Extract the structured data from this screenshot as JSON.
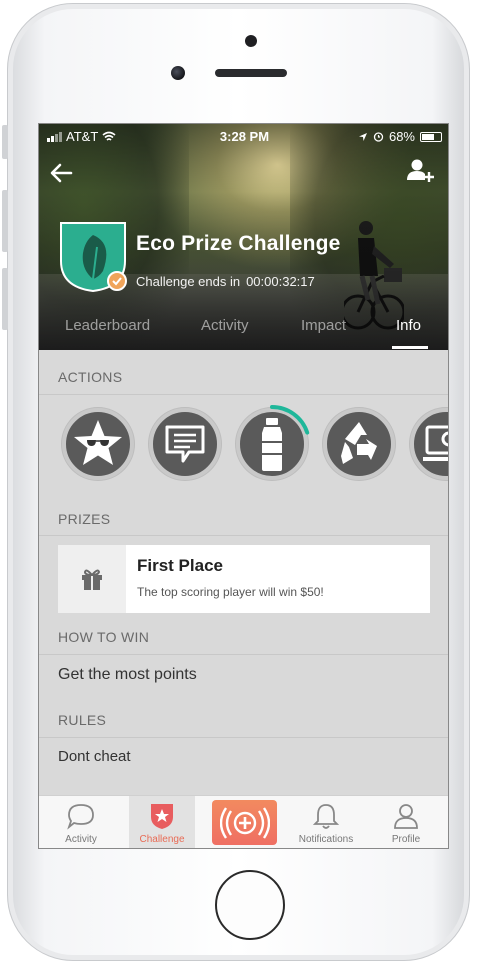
{
  "status_bar": {
    "carrier": "AT&T",
    "time": "3:28 PM",
    "battery": "68%",
    "battery_level": 0.68
  },
  "header": {
    "title": "Eco Prize Challenge",
    "ends_label": "Challenge ends in",
    "timer": "00:00:32:17"
  },
  "tabs": [
    {
      "label": "Leaderboard"
    },
    {
      "label": "Activity"
    },
    {
      "label": "Impact"
    },
    {
      "label": "Info",
      "active": true
    }
  ],
  "sections": {
    "actions": "ACTIONS",
    "prizes": "PRIZES",
    "how_to_win": "HOW TO WIN",
    "rules": "RULES"
  },
  "actions": [
    {
      "icon": "star-sunglasses-icon"
    },
    {
      "icon": "message-icon"
    },
    {
      "icon": "water-bottle-icon",
      "progress": 0.2
    },
    {
      "icon": "recycle-icon"
    },
    {
      "icon": "computer-settings-icon"
    }
  ],
  "prize": {
    "title": "First Place",
    "description": "The top scoring player will win $50!",
    "icon": "gift-icon"
  },
  "how_to_win": "Get the most points",
  "rules": "Dont cheat",
  "bottom_nav": [
    {
      "label": "Activity",
      "icon": "chat-bubble-icon"
    },
    {
      "label": "Challenge",
      "icon": "star-shield-icon",
      "active": true
    },
    {
      "label": "",
      "icon": "broadcast-plus-icon"
    },
    {
      "label": "Notifications",
      "icon": "bell-icon"
    },
    {
      "label": "Profile",
      "icon": "user-icon"
    }
  ],
  "colors": {
    "accent": "#ef6f63",
    "badge_green": "#2bae8f",
    "badge_check": "#f0a45a",
    "progress_teal": "#1fb79a"
  }
}
